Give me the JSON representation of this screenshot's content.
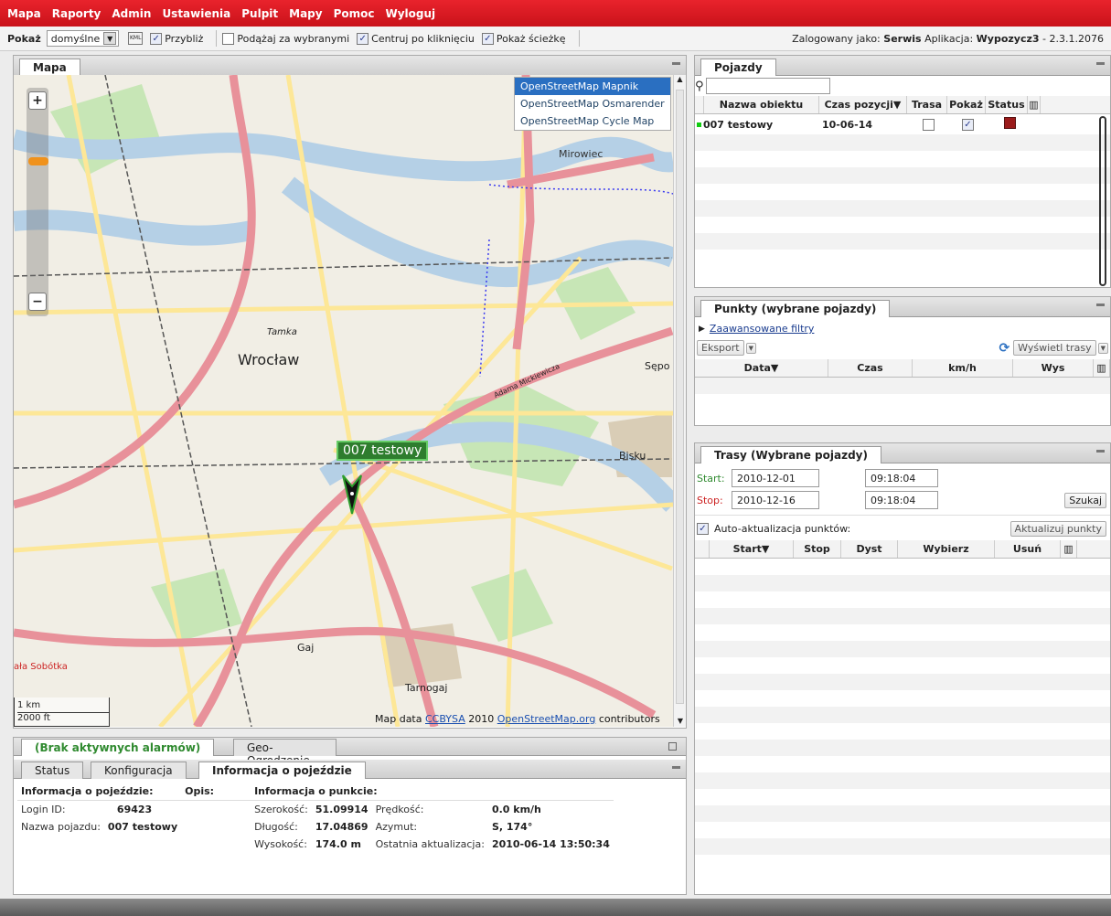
{
  "menu": [
    "Mapa",
    "Raporty",
    "Admin",
    "Ustawienia",
    "Pulpit",
    "Mapy",
    "Pomoc",
    "Wyloguj"
  ],
  "toolbar": {
    "show_label": "Pokaż",
    "show_value": "domyślne",
    "zoom": "Przybliż",
    "follow": "Podążaj za wybranymi",
    "center": "Centruj po kliknięciu",
    "path": "Pokaż ścieżkę",
    "login_prefix": "Zalogowany jako:",
    "login_user": "Serwis",
    "app_prefix": "Aplikacja:",
    "app_name": "Wypozycz3",
    "version": "- 2.3.1.2076"
  },
  "map": {
    "tab": "Mapa",
    "layers": [
      "OpenStreetMap Mapnik",
      "OpenStreetMap Osmarender",
      "OpenStreetMap Cycle Map"
    ],
    "scale_km": "1 km",
    "scale_ft": "2000 ft",
    "attrib_prefix": "Map data",
    "attrib_license": "CCBYSA",
    "attrib_year": "2010",
    "attrib_osm": "OpenStreetMap.org",
    "attrib_suffix": "contributors",
    "vehicle_label": "007 testowy",
    "places": [
      "Mirowiec",
      "Wrocław",
      "Tamka",
      "Gaj",
      "Tarnogaj",
      "Sępo",
      "Bisku",
      "ała Sobótka",
      "Adama Mickiewicza"
    ]
  },
  "vehicles": {
    "tab": "Pojazdy",
    "cols": [
      "Nazwa obiektu",
      "Czas pozycji▼",
      "Trasa",
      "Pokaż",
      "Status"
    ],
    "row": {
      "name": "007 testowy",
      "time": "10-06-14"
    }
  },
  "points": {
    "tab": "Punkty (wybrane pojazdy)",
    "filters": "Zaawansowane filtry",
    "export": "Eksport",
    "show_routes": "Wyświetl trasy",
    "cols": [
      "Data▼",
      "Czas",
      "km/h",
      "Wys"
    ]
  },
  "routes": {
    "tab": "Trasy (Wybrane pojazdy)",
    "start_label": "Start:",
    "start_date": "2010-12-01",
    "start_time": "09:18:04",
    "stop_label": "Stop:",
    "stop_date": "2010-12-16",
    "stop_time": "09:18:04",
    "search": "Szukaj",
    "auto": "Auto-aktualizacja punktów:",
    "update": "Aktualizuj punkty",
    "cols": [
      "Start▼",
      "Stop",
      "Dyst",
      "Wybierz",
      "Usuń"
    ]
  },
  "alarms": {
    "tab1": "(Brak aktywnych alarmów)",
    "tab2": "Geo-Ogrodzenie"
  },
  "info": {
    "tabs": [
      "Status",
      "Konfiguracja",
      "Informacja o pojeździe"
    ],
    "h_vehicle": "Informacja o pojeździe:",
    "h_desc": "Opis:",
    "h_point": "Informacja o punkcie:",
    "login_k": "Login ID:",
    "login_v": "69423",
    "name_k": "Nazwa pojazdu:",
    "name_v": "007 testowy",
    "lat_k": "Szerokość:",
    "lat_v": "51.09914",
    "lon_k": "Długość:",
    "lon_v": "17.04869",
    "alt_k": "Wysokość:",
    "alt_v": "174.0 m",
    "speed_k": "Prędkość:",
    "speed_v": "0.0 km/h",
    "az_k": "Azymut:",
    "az_v": "S, 174°",
    "upd_k": "Ostatnia aktualizacja:",
    "upd_v": "2010-06-14 13:50:34"
  }
}
